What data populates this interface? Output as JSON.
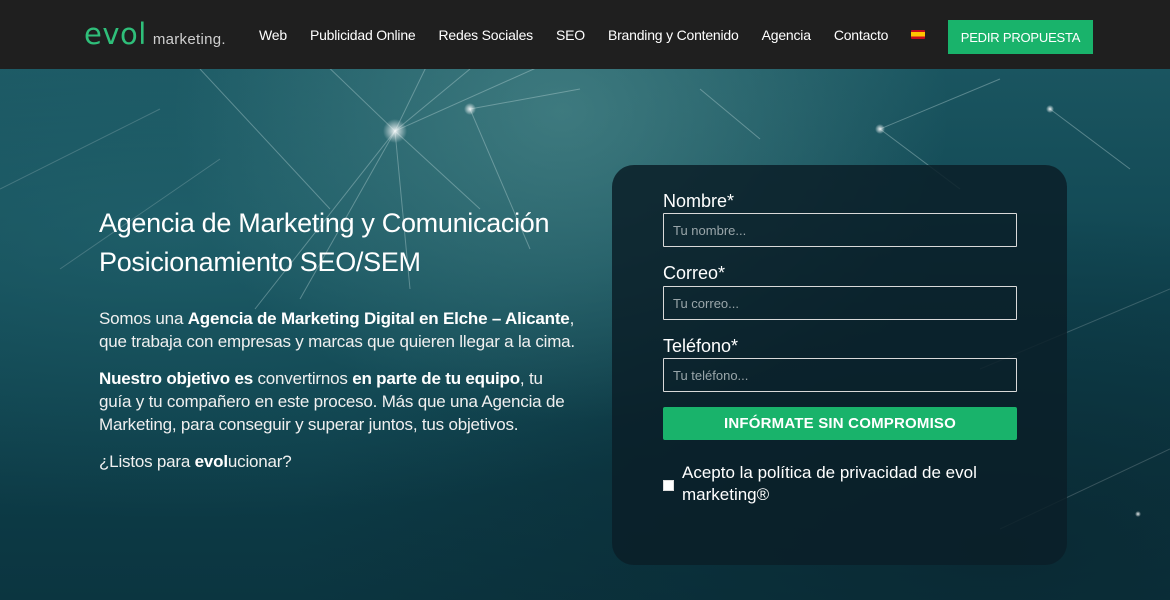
{
  "header": {
    "logo_main": "evol",
    "logo_sub": "marketing.",
    "nav": [
      "Web",
      "Publicidad Online",
      "Redes Sociales",
      "SEO",
      "Branding y Contenido",
      "Agencia",
      "Contacto"
    ],
    "language_flag": "es-flag-icon",
    "cta_label": "PEDIR PROPUESTA"
  },
  "hero": {
    "headline_line1": "Agencia de Marketing y Comunicación",
    "headline_line2": "Posicionamiento SEO/SEM",
    "p1_a": "Somos una ",
    "p1_b": "Agencia de Marketing Digital en Elche – Alicante",
    "p1_c": ", que trabaja con empresas y marcas que quieren llegar a la cima.",
    "p2_a": "Nuestro objetivo es",
    "p2_b": " convertirnos ",
    "p2_c": "en parte de tu equipo",
    "p2_d": ", tu guía y tu compañero en este proceso. Más que una Agencia de Marketing, para conseguir y superar juntos, tus objetivos.",
    "p3_a": "¿Listos para ",
    "p3_b": "evol",
    "p3_c": "ucionar?"
  },
  "form": {
    "name_label": "Nombre*",
    "name_placeholder": "Tu nombre...",
    "email_label": "Correo*",
    "email_placeholder": "Tu correo...",
    "phone_label": "Teléfono*",
    "phone_placeholder": "Tu teléfono...",
    "submit_label": "INFÓRMATE SIN COMPROMISO",
    "consent_text": "Acepto la política de privacidad de evol marketing®"
  },
  "colors": {
    "accent": "#19b36b",
    "header_bg": "#1f1f1f"
  }
}
